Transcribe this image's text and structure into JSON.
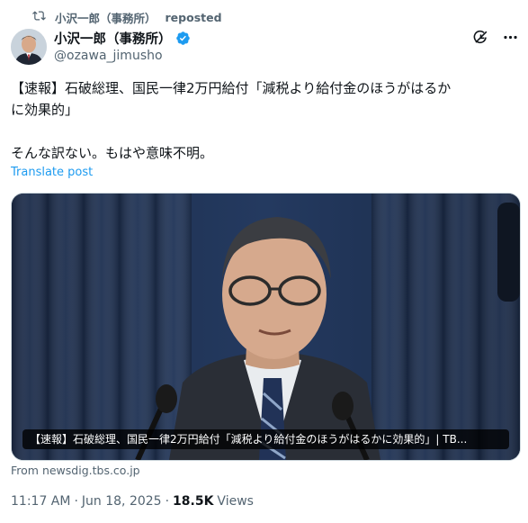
{
  "repost": {
    "icon": "repost-icon",
    "name": "小沢一郎（事務所）",
    "action": "reposted"
  },
  "author": {
    "name": "小沢一郎（事務所）",
    "handle": "@ozawa_jimusho",
    "verified": true,
    "verified_color": "#1d9bf0"
  },
  "top_actions": {
    "icons": [
      "grok-icon",
      "more-icon"
    ]
  },
  "tweet": {
    "line1": "【速報】石破総理、国民一律2万円給付「減税より給付金のほうがはるか",
    "line2": "に効果的」",
    "line3": "そんな訳ない。もはや意味不明。"
  },
  "translate_label": "Translate post",
  "media": {
    "caption": "【速報】石破総理、国民一律2万円給付「減税より給付金のほうがはるかに効果的」| TB..."
  },
  "link_source": "From newsdig.tbs.co.jp",
  "meta": {
    "time": "11:17 AM",
    "sep1": "·",
    "date": "Jun 18, 2025",
    "sep2": "·",
    "views_count": "18.5K",
    "views_label": "Views"
  },
  "colors": {
    "accent": "#1d9bf0",
    "secondary_text": "#536471",
    "primary_text": "#0f1419"
  }
}
